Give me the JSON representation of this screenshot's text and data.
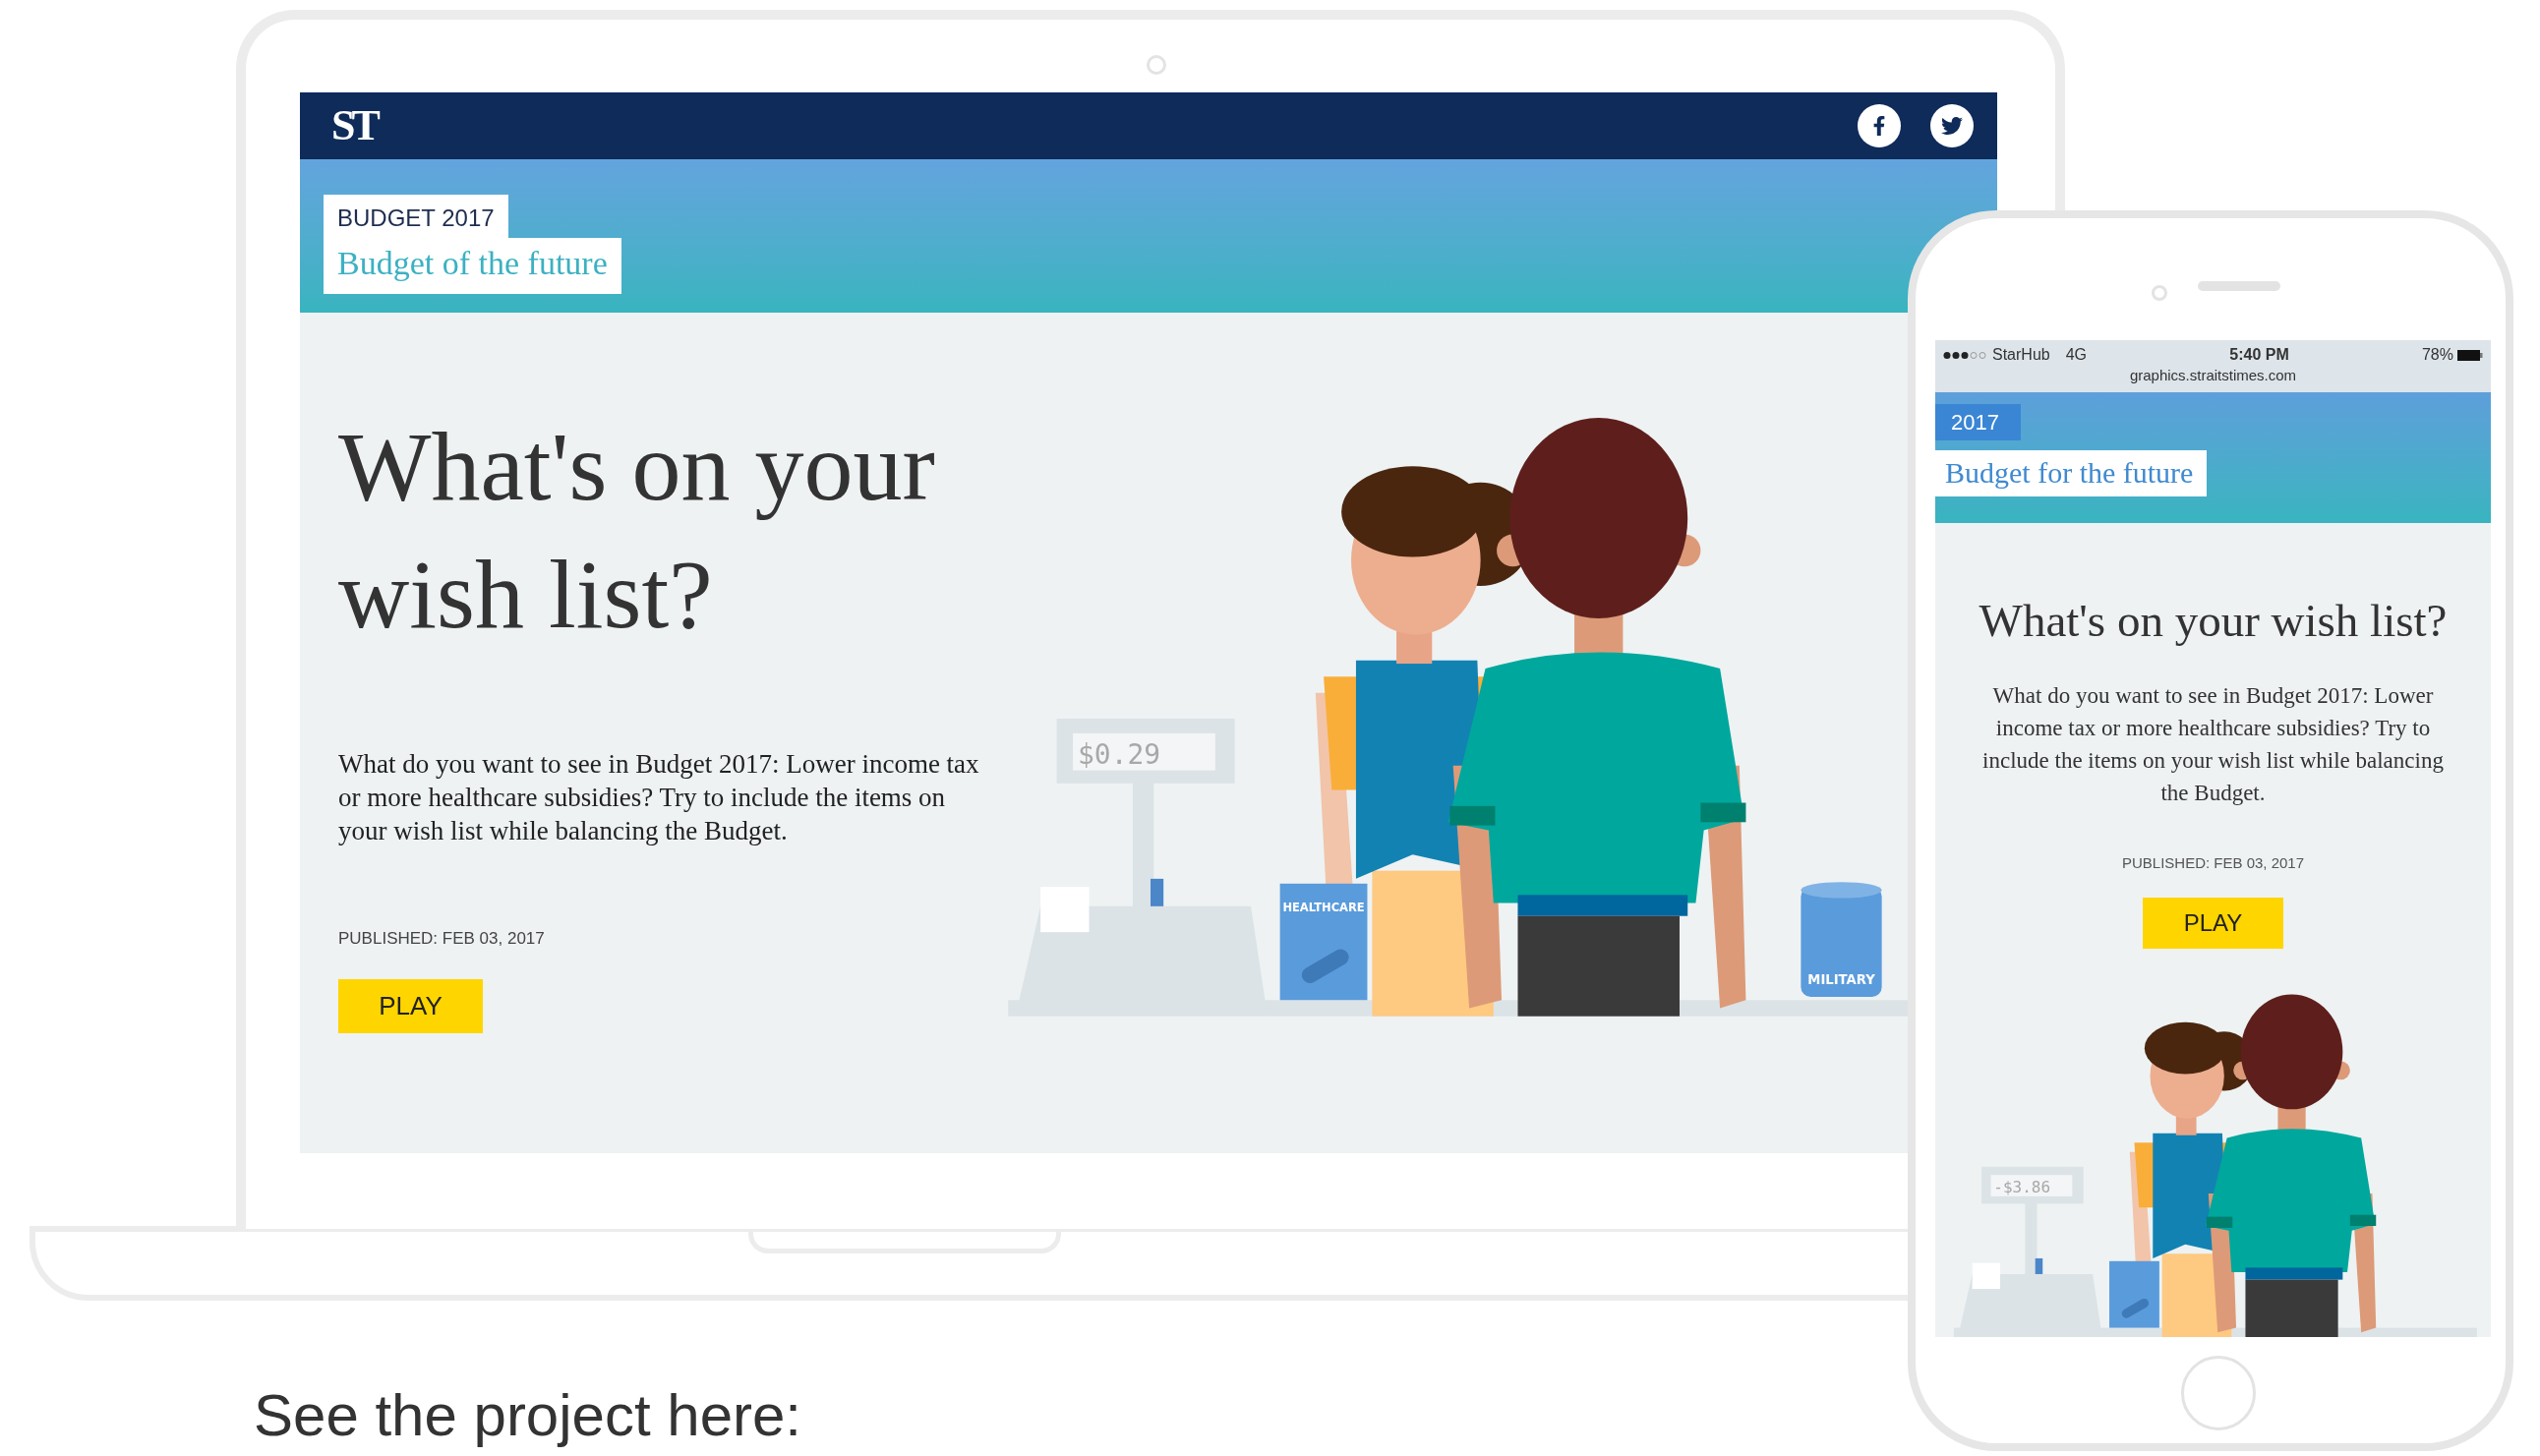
{
  "laptop": {
    "header": {
      "logo": "ST"
    },
    "banner": {
      "tag": "BUDGET 2017",
      "title": "Budget of the future"
    },
    "headline": "What's on your wish list?",
    "intro": "What do you want to see in Budget 2017: Lower income tax or more healthcare subsidies? Try to include the items on your wish list while balancing the Budget.",
    "published": "PUBLISHED: FEB 03, 2017",
    "play_button": "PLAY",
    "illustration": {
      "price": "$0.29",
      "items": [
        {
          "kind": "box",
          "label": "HEALTHCARE"
        },
        {
          "kind": "can",
          "label": "MILITARY"
        }
      ]
    }
  },
  "phone": {
    "status_bar": {
      "carrier": "StarHub",
      "network": "4G",
      "time": "5:40 PM",
      "battery": "78%",
      "url": "graphics.straitstimes.com"
    },
    "banner": {
      "tag": "2017",
      "title": "Budget for the future"
    },
    "headline": "What's on your wish list?",
    "intro": "What do you want to see in Budget 2017: Lower income tax or more healthcare subsidies? Try to include the items on your wish list while balancing the Budget.",
    "published": "PUBLISHED: FEB 03, 2017",
    "play_button": "PLAY",
    "illustration": {
      "price": "-$3.86",
      "items": [
        {
          "kind": "box"
        }
      ]
    }
  },
  "caption": "See the project here:"
}
